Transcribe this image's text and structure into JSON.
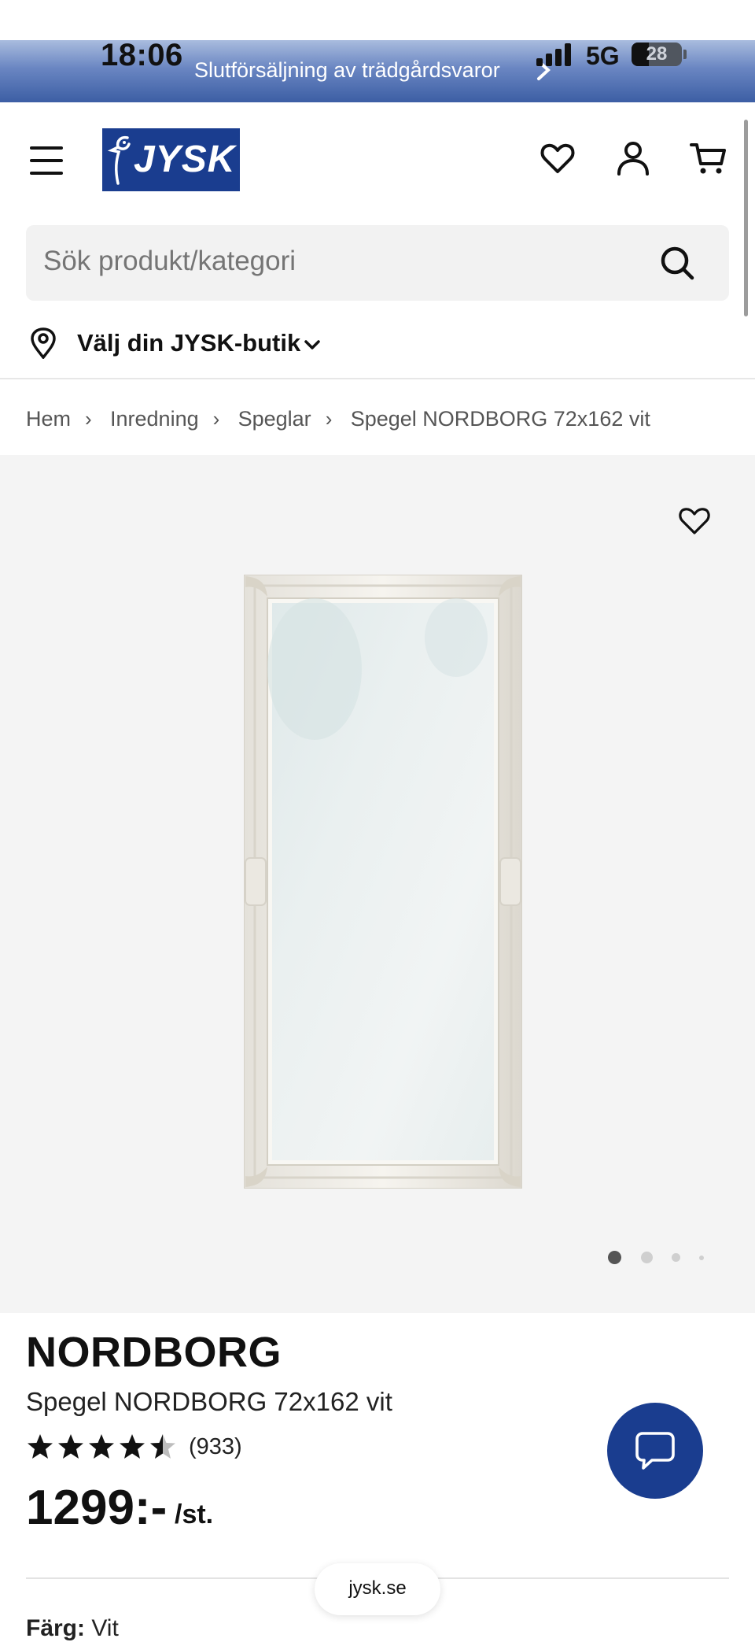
{
  "status_bar": {
    "time": "18:06",
    "network": "5G",
    "battery_level": "28"
  },
  "promo": {
    "text": "Slutförsäljning av trädgårdsvaror"
  },
  "header": {
    "logo_text": "JYSK",
    "icons": [
      "menu-icon",
      "heart-icon",
      "account-icon",
      "cart-icon"
    ],
    "brand_color": "#1a3d8f"
  },
  "search": {
    "placeholder": "Sök produkt/kategori"
  },
  "store": {
    "label": "Välj din JYSK-butik"
  },
  "breadcrumb": {
    "items": [
      "Hem",
      "Inredning",
      "Speglar",
      "Spegel NORDBORG 72x162 vit"
    ]
  },
  "gallery": {
    "active_slide": 1,
    "slide_count": 4
  },
  "product": {
    "brand": "NORDBORG",
    "name": "Spegel NORDBORG 72x162 vit",
    "rating": 4.5,
    "rating_max": 5,
    "rating_count": "(933)",
    "price": "1299:-",
    "unit": "/st.",
    "color_label": "Färg:",
    "color_value": "Vit"
  },
  "browser": {
    "url": "jysk.se"
  }
}
